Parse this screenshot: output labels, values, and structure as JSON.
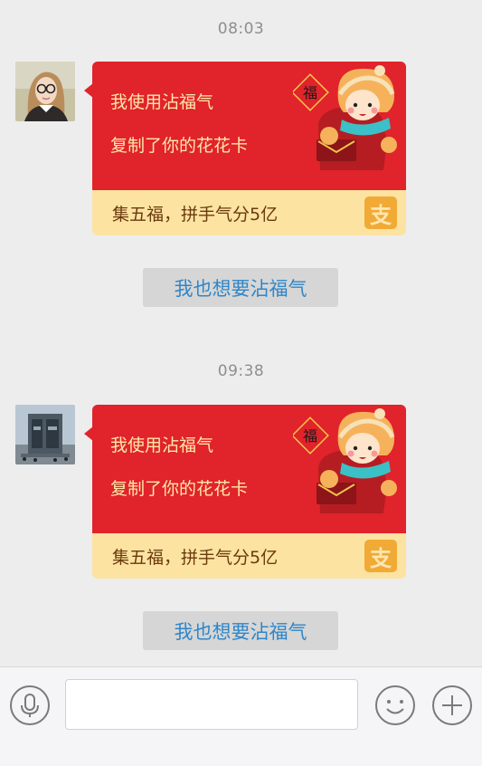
{
  "messages": [
    {
      "time": "08:03",
      "card": {
        "line1": "我使用沾福气",
        "line2": "复制了你的花花卡",
        "footer": "集五福，拼手气分5亿",
        "badge": "福",
        "logo_char": "支"
      },
      "action_label": "我也想要沾福气"
    },
    {
      "time": "09:38",
      "card": {
        "line1": "我使用沾福气",
        "line2": "复制了你的花花卡",
        "footer": "集五福，拼手气分5亿",
        "badge": "福",
        "logo_char": "支"
      },
      "action_label": "我也想要沾福气"
    }
  ],
  "input_bar": {
    "placeholder": "",
    "icons": [
      "microphone-icon",
      "emoji-icon",
      "plus-icon"
    ]
  },
  "colors": {
    "card_red": "#e1232b",
    "card_footer": "#fde3a2",
    "card_text": "#fde8a8",
    "footer_text": "#6a3a0d",
    "link_blue": "#2f86c9",
    "alipay_orange": "#f0aa35"
  }
}
